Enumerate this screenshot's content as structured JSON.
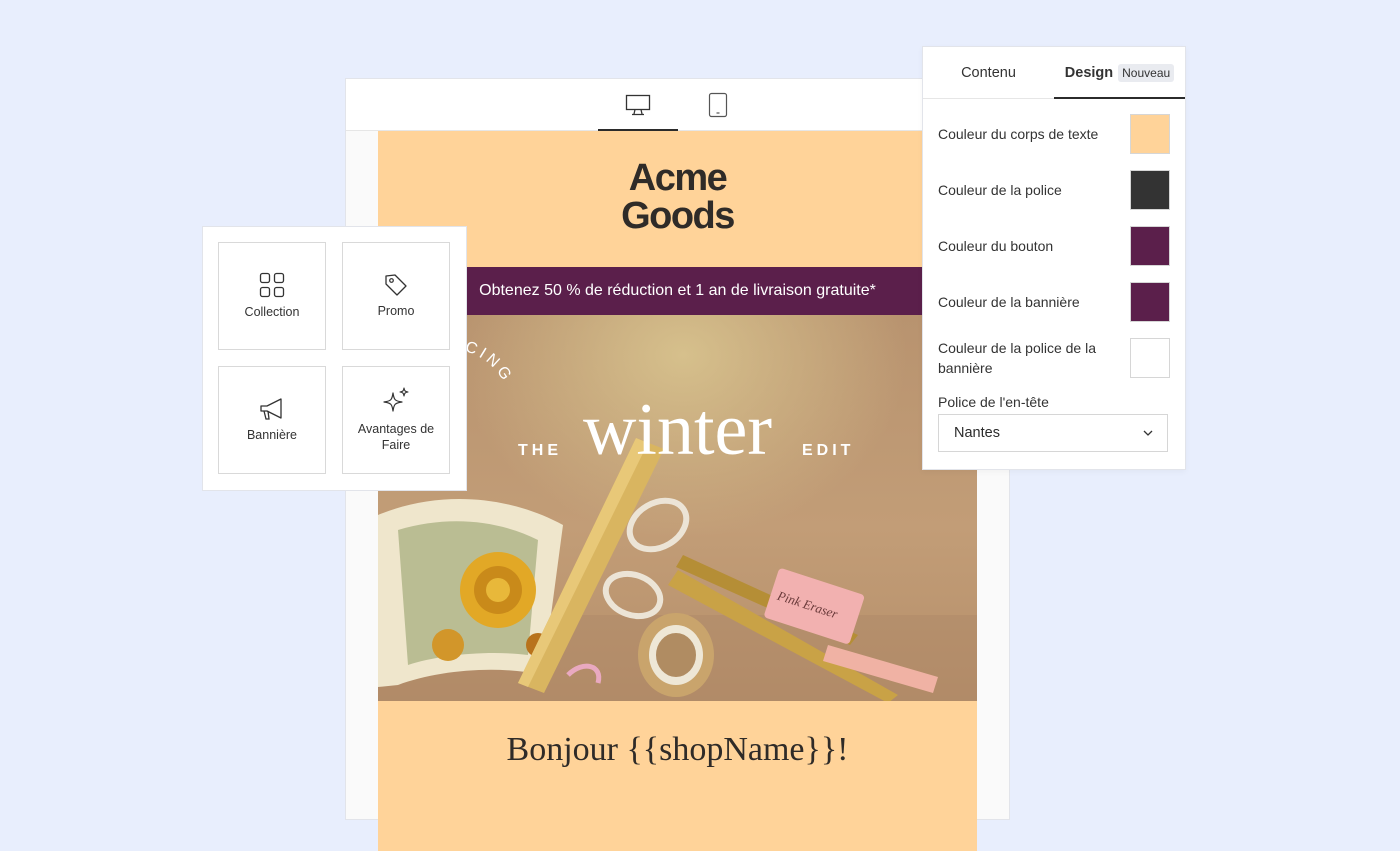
{
  "editor": {
    "device_tabs": [
      {
        "icon": "desktop-icon",
        "active": true
      },
      {
        "icon": "tablet-icon",
        "active": false
      }
    ]
  },
  "email": {
    "logo_line1": "Acme",
    "logo_line2": "Goods",
    "banner": "Obtenez 50 % de réduction et 1 an de livraison gratuite*",
    "hero": {
      "introducing": "INTRODUCING",
      "the": "THE",
      "winter": "winter",
      "edit": "EDIT",
      "eraser_text": "Pink Eraser"
    },
    "greeting": "Bonjour {{shopName}}!"
  },
  "palette": {
    "blocks": [
      {
        "label": "Collection",
        "icon": "grid-icon"
      },
      {
        "label": "Promo",
        "icon": "tag-icon"
      },
      {
        "label": "Bannière",
        "icon": "megaphone-icon"
      },
      {
        "label": "Avantages de Faire",
        "icon": "sparkle-icon"
      }
    ]
  },
  "panel": {
    "tabs": [
      {
        "label": "Contenu",
        "active": false
      },
      {
        "label": "Design",
        "active": true,
        "badge": "Nouveau"
      }
    ],
    "settings": [
      {
        "label": "Couleur du corps de texte",
        "color": "#ffd399"
      },
      {
        "label": "Couleur de la police",
        "color": "#333333"
      },
      {
        "label": "Couleur du bouton",
        "color": "#5b1f4b"
      },
      {
        "label": "Couleur de la bannière",
        "color": "#5b1f4b"
      },
      {
        "label": "Couleur de la police de la bannière",
        "color": "#ffffff"
      }
    ],
    "header_font": {
      "label": "Police de l'en-tête",
      "value": "Nantes"
    }
  },
  "colors": {
    "background": "#e8eefd",
    "email_body": "#ffd399",
    "banner": "#5b1f4b",
    "text": "#2b2b2b"
  }
}
